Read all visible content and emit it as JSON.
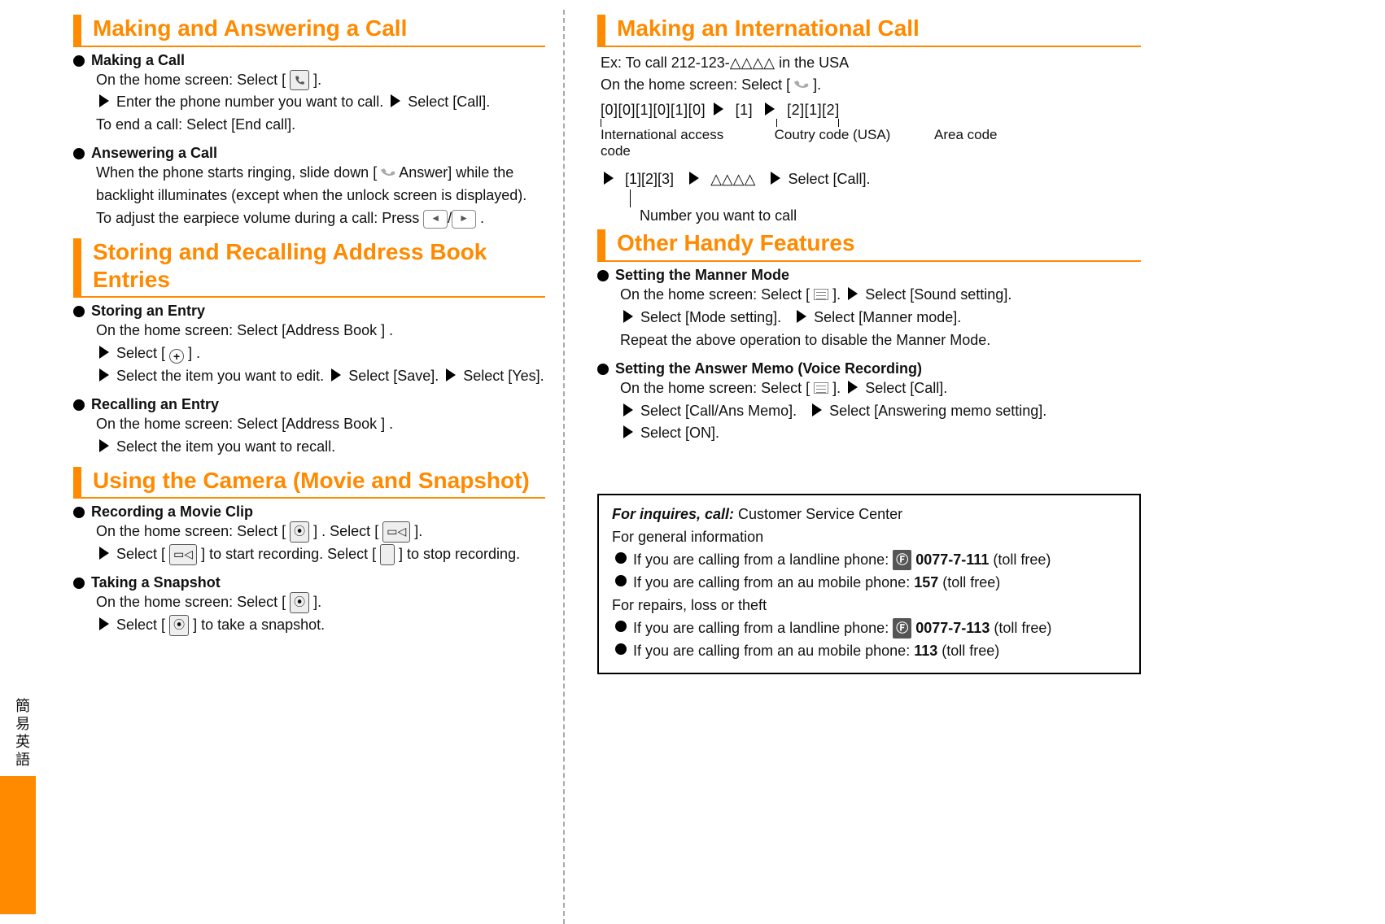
{
  "side_label": "簡易英語",
  "left": {
    "s1": {
      "heading": "Making and Answering a Call",
      "i1": {
        "title": "Making a Call",
        "l1a": "On the home screen: Select [",
        "l1b": "].",
        "l2a": "Enter the phone number you want to call.",
        "l2b": "Select [Call].",
        "l3": "To end a call: Select [End call]."
      },
      "i2": {
        "title": "Ansewering a Call",
        "l1a": "When the phone starts ringing, slide down [",
        "l1b": "Answer] while the backlight illuminates (except when the unlock screen is displayed).",
        "l2": "To adjust the earpiece volume during a call: Press",
        "l2end": "."
      }
    },
    "s2": {
      "heading": "Storing and Recalling Address Book Entries",
      "i1": {
        "title": "Storing an Entry",
        "l1": "On the home screen: Select [Address Book ]    .",
        "l2a": "Select [",
        "l2b": "] .",
        "l3a": "Select the item you want to edit.",
        "l3b": "Select [Save].",
        "l3c": "Select [Yes]."
      },
      "i2": {
        "title": "Recalling an Entry",
        "l1": "On the home screen: Select [Address Book ]    .",
        "l2": "Select the item you want to recall."
      }
    },
    "s3": {
      "heading": "Using the Camera (Movie and Snapshot)",
      "i1": {
        "title": "Recording a Movie Clip",
        "l1a": "On the home screen: Select [",
        "l1b": "]    .    Select [",
        "l1c": "].",
        "l2a": "Select [",
        "l2b": "] to start recording.    Select [",
        "l2c": "] to stop recording."
      },
      "i2": {
        "title": "Taking a Snapshot",
        "l1a": "On the home screen: Select [",
        "l1b": "].",
        "l2a": "Select [",
        "l2b": "] to take a snapshot."
      }
    }
  },
  "right": {
    "s1": {
      "heading": "Making an International Call",
      "ex1": "Ex: To call 212-123-△△△△ in the USA",
      "ex2a": "On the home screen: Select [",
      "ex2b": "].",
      "dial1": "[0][0][1][0][1][0]",
      "dial2": "[1]",
      "dial3": "[2][1][2]",
      "lab1": "International access code",
      "lab2": "Coutry code (USA)",
      "lab3": "Area code",
      "dial4": "[1][2][3]",
      "dial5": "△△△△",
      "dial6": "Select [Call].",
      "lab4": "Number you want to call"
    },
    "s2": {
      "heading": "Other Handy Features",
      "i1": {
        "title": "Setting the Manner Mode",
        "l1a": "On the home screen: Select [",
        "l1b": "].",
        "l1c": "Select [Sound setting].",
        "l2a": "Select [Mode setting].",
        "l2b": "Select [Manner mode].",
        "l3": "Repeat the above operation to disable the Manner Mode."
      },
      "i2": {
        "title": "Setting the Answer Memo (Voice Recording)",
        "l1a": "On the home screen: Select [",
        "l1b": "].",
        "l1c": "Select [Call].",
        "l2a": "Select [Call/Ans Memo].",
        "l2b": "Select [Answering memo setting].",
        "l3": "Select [ON]."
      }
    },
    "info": {
      "head1a": "For inquires, call:",
      "head1b": "Customer Service Center",
      "head2": "For general information",
      "b1a": "If you are calling from a landline phone:",
      "b1n": "0077-7-111",
      "b1s": "(toll free)",
      "b2a": "If you are calling from an au mobile phone:",
      "b2n": "157",
      "b2s": "(toll free)",
      "head3": "For repairs, loss or theft",
      "b3a": "If you are calling from a landline phone:",
      "b3n": "0077-7-113",
      "b3s": "(toll free)",
      "b4a": "If you are calling from an au mobile phone:",
      "b4n": "113",
      "b4s": "(toll free)"
    }
  }
}
